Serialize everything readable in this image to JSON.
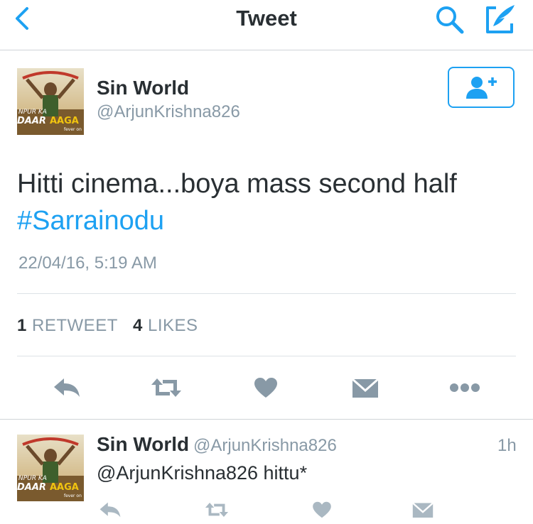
{
  "colors": {
    "accent": "#1da1f2",
    "secondary_text": "#8899a6",
    "icon_gray": "#8899a6",
    "primary_text": "#292f33"
  },
  "nav": {
    "title": "Tweet",
    "back_icon": "chevron-left-icon",
    "search_icon": "search-icon",
    "compose_icon": "compose-icon"
  },
  "tweet": {
    "author_name": "Sin World",
    "author_handle": "@ArjunKrishna826",
    "text": "Hitti cinema...boya mass second half",
    "hashtag": "#Sarrainodu",
    "timestamp": "22/04/16, 5:19 AM",
    "retweet_count": "1",
    "retweet_label": "RETWEET",
    "likes_count": "4",
    "likes_label": "LIKES",
    "avatar_text": {
      "line1": "NPUR KA",
      "line2": "DAAR",
      "line3": "AAGA",
      "line4": "fever on"
    }
  },
  "reply": {
    "author_name": "Sin World",
    "author_handle": "@ArjunKrishna826",
    "time": "1h",
    "text": "@ArjunKrishna826 hittu*"
  }
}
